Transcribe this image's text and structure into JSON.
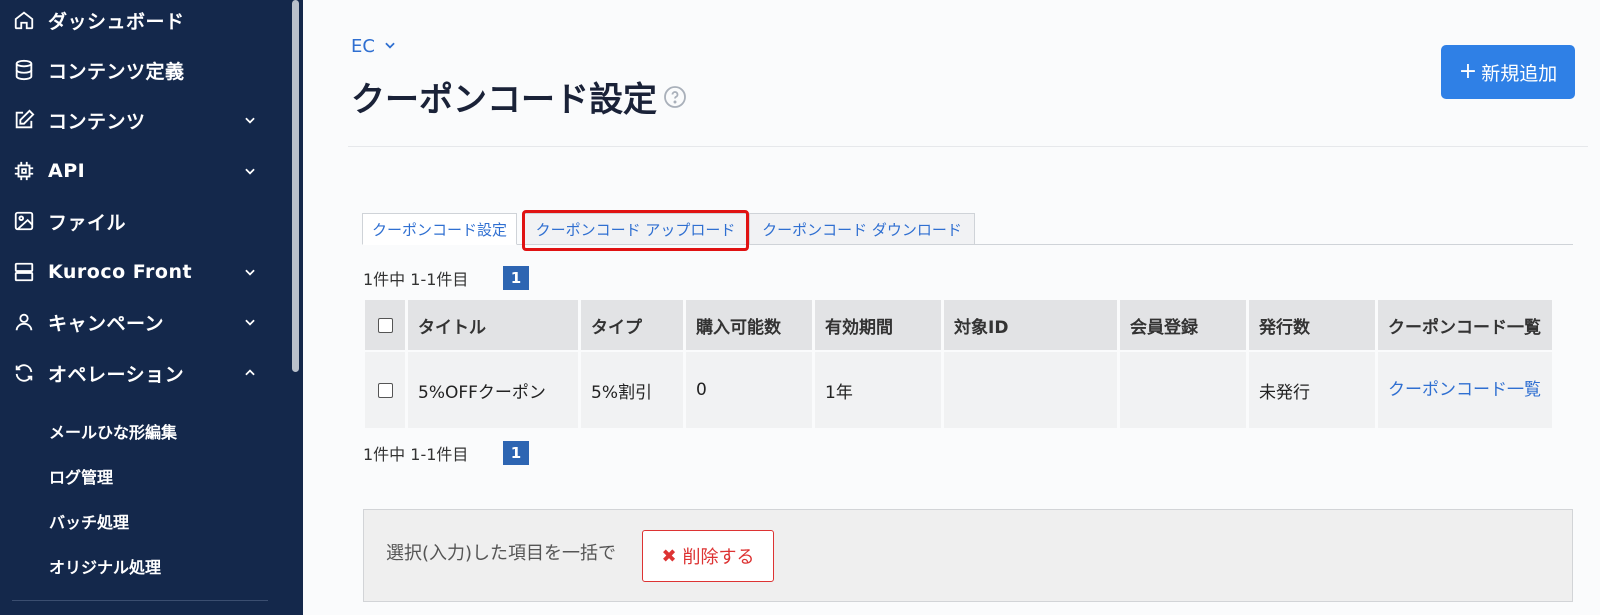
{
  "sidebar": {
    "items": [
      {
        "label": "ダッシュボード",
        "icon": "home-icon"
      },
      {
        "label": "コンテンツ定義",
        "icon": "database-icon"
      },
      {
        "label": "コンテンツ",
        "icon": "edit-icon"
      },
      {
        "label": "API",
        "icon": "chip-icon"
      },
      {
        "label": "ファイル",
        "icon": "image-icon"
      },
      {
        "label": "Kuroco Front",
        "icon": "server-icon"
      },
      {
        "label": "キャンペーン",
        "icon": "user-icon"
      },
      {
        "label": "オペレーション",
        "icon": "refresh-icon"
      }
    ],
    "sub_items": [
      "メールひな形編集",
      "ログ管理",
      "バッチ処理",
      "オリジナル処理"
    ]
  },
  "header": {
    "breadcrumb": "EC",
    "title": "クーポンコード設定",
    "add_button": "新規追加"
  },
  "tabs": [
    "クーポンコード設定",
    "クーポンコード アップロード",
    "クーポンコード ダウンロード"
  ],
  "pagination": {
    "summary": "1件中 1-1件目",
    "page": "1"
  },
  "table": {
    "headers": [
      "タイトル",
      "タイプ",
      "購入可能数",
      "有効期間",
      "対象ID",
      "会員登録",
      "発行数",
      "クーポンコード一覧"
    ],
    "rows": [
      {
        "title": "5%OFFクーポン",
        "type": "5%割引",
        "purchasable": "0",
        "validity": "1年",
        "target_id": "",
        "member": "",
        "issued": "未発行",
        "list_link": "クーポンコード一覧"
      }
    ]
  },
  "bulk": {
    "text": "選択(入力)した項目を一括で",
    "delete_button": "削除する"
  },
  "colors": {
    "sidebar": "#14284b",
    "accent": "#2f80e6",
    "link": "#2f6fd1",
    "danger": "#dd3333",
    "highlight": "#e01212"
  }
}
